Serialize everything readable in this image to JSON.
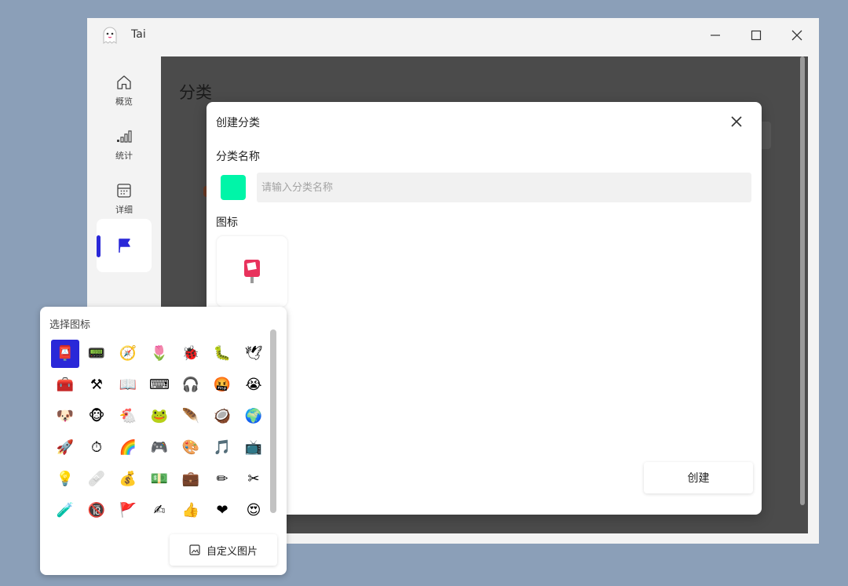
{
  "app": {
    "title": "Tai"
  },
  "sidebar": {
    "items": [
      {
        "label": "概览",
        "icon": "home-icon"
      },
      {
        "label": "统计",
        "icon": "bar-signal-icon"
      },
      {
        "label": "详细",
        "icon": "calendar-icon"
      },
      {
        "label": "",
        "icon": "flag-icon",
        "active": true
      }
    ]
  },
  "page": {
    "title": "分类"
  },
  "dialog": {
    "title": "创建分类",
    "name_label": "分类名称",
    "name_placeholder": "请输入分类名称",
    "name_value": "",
    "color": "#00f5a8",
    "icon_label": "图标",
    "selected_icon": "📮",
    "create_label": "创建"
  },
  "picker": {
    "title": "选择图标",
    "icons": [
      "📮",
      "📟",
      "🧭",
      "🌷",
      "🐞",
      "🐛",
      "🕊",
      "🧰",
      "⚒",
      "📖",
      "⌨",
      "🎧",
      "🤬",
      "😭",
      "🐶",
      "🐵",
      "🐔",
      "🐸",
      "🪶",
      "🥥",
      "🌍",
      "🚀",
      "⏱",
      "🌈",
      "🎮",
      "🎨",
      "🎵",
      "📺",
      "💡",
      "🩹",
      "💰",
      "💵",
      "💼",
      "✏",
      "✂",
      "🧪",
      "🔞",
      "🚩",
      "✍",
      "👍",
      "❤",
      "😍"
    ],
    "custom_label": "自定义图片"
  },
  "colors": {
    "accent": "#2a28d8",
    "overlay": "#4b4b4b",
    "desktop": "#8b9fb8"
  }
}
